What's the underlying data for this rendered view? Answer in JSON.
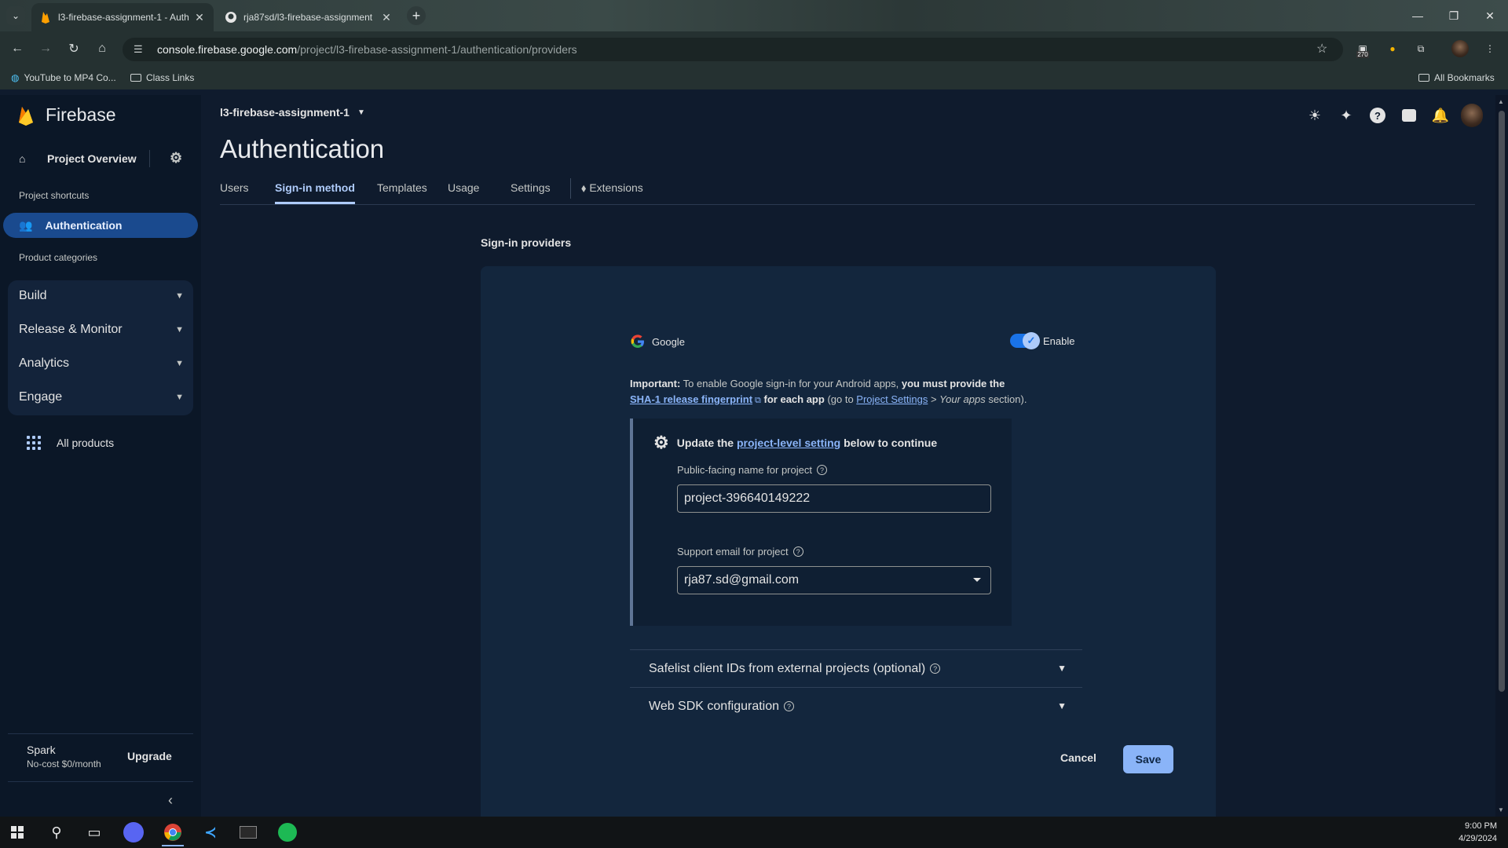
{
  "browser": {
    "tabs": [
      {
        "title": "l3-firebase-assignment-1 - Auth",
        "active": true
      },
      {
        "title": "rja87sd/l3-firebase-assignment",
        "active": false
      }
    ],
    "url_host": "console.firebase.google.com",
    "url_path": "/project/l3-firebase-assignment-1/authentication/providers",
    "extension_badge": "270",
    "bookmarks": [
      {
        "label": "YouTube to MP4 Co..."
      },
      {
        "label": "Class Links"
      }
    ],
    "all_bookmarks": "All Bookmarks"
  },
  "sidebar": {
    "brand": "Firebase",
    "project_overview": "Project Overview",
    "project_shortcuts_label": "Project shortcuts",
    "active_item": "Authentication",
    "product_categories_label": "Product categories",
    "categories": [
      {
        "label": "Build"
      },
      {
        "label": "Release & Monitor"
      },
      {
        "label": "Analytics"
      },
      {
        "label": "Engage"
      }
    ],
    "all_products": "All products",
    "plan_name": "Spark",
    "plan_desc": "No-cost $0/month",
    "upgrade": "Upgrade"
  },
  "header": {
    "project_name": "l3-firebase-assignment-1",
    "page_title": "Authentication",
    "tabs": [
      {
        "label": "Users"
      },
      {
        "label": "Sign-in method",
        "active": true
      },
      {
        "label": "Templates"
      },
      {
        "label": "Usage"
      },
      {
        "label": "Settings"
      },
      {
        "label": "Extensions"
      }
    ]
  },
  "content": {
    "section_title": "Sign-in providers",
    "provider_name": "Google",
    "toggle_label": "Enable",
    "toggle_on": true,
    "important": {
      "lead": "Important:",
      "text1": " To enable Google sign-in for your Android apps, ",
      "bold1": "you must provide the",
      "link1": "SHA-1 release fingerprint",
      "bold2": " for each app",
      "text2": " (go to ",
      "link2": "Project Settings",
      "text3": " > ",
      "italic": "Your apps",
      "text4": " section)."
    },
    "callout": {
      "prefix": "Update the ",
      "link": "project-level setting",
      "suffix": " below to continue",
      "public_name_label": "Public-facing name for project",
      "public_name_value": "project-396640149222",
      "support_email_label": "Support email for project",
      "support_email_value": "rja87.sd@gmail.com"
    },
    "expanders": [
      {
        "label": "Safelist client IDs from external projects (optional)"
      },
      {
        "label": "Web SDK configuration"
      }
    ],
    "cancel": "Cancel",
    "save": "Save"
  },
  "taskbar": {
    "time": "9:00 PM",
    "date": "4/29/2024"
  },
  "colors": {
    "accent": "#8ab4f8",
    "active_nav": "#1a4a8e",
    "page_bg": "#0f1b2d",
    "card_bg": "#13263d"
  }
}
